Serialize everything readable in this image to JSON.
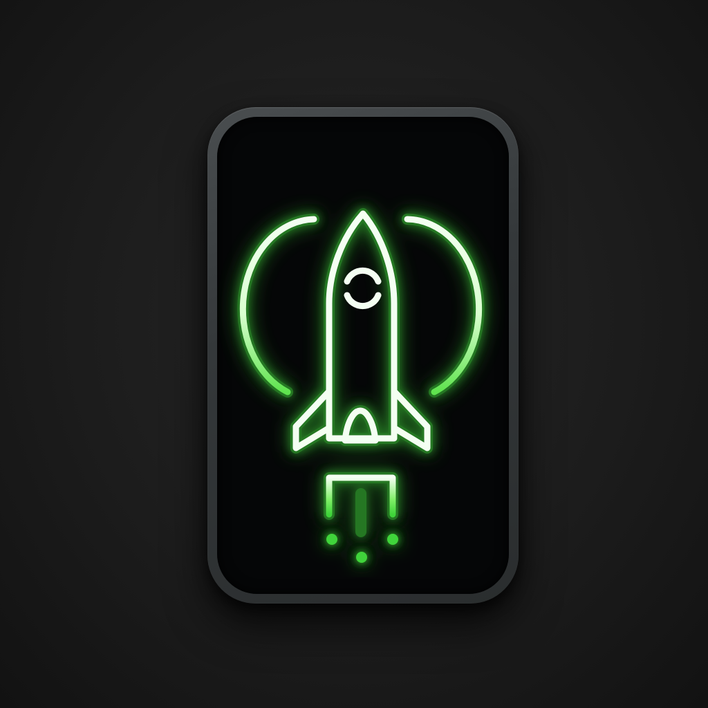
{
  "icon": "rocket-launch-icon",
  "colors": {
    "background": "#1b1b1b",
    "device_frame": "#3a3e40",
    "screen": "#050607",
    "glow_green": "#3fd43a",
    "stroke_white": "#f4fff2"
  }
}
